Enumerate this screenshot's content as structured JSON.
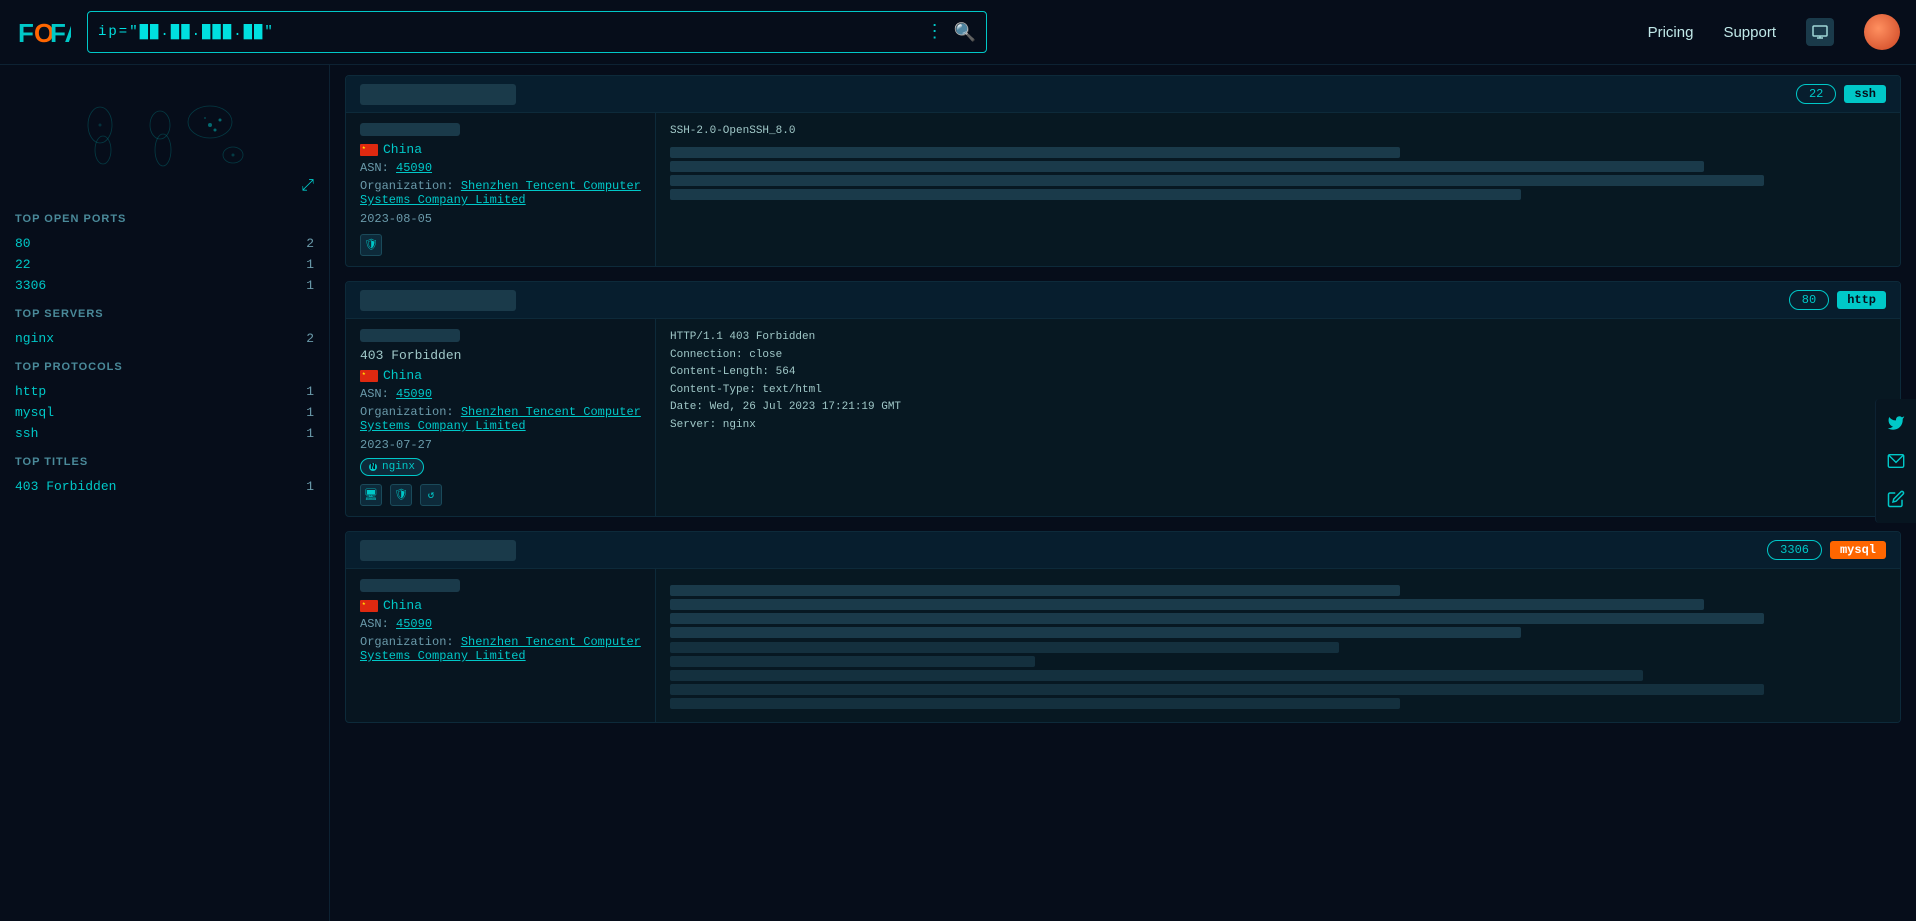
{
  "header": {
    "logo_text": "FOFA",
    "search_value": "ip=\"██.██.███.██\"",
    "nav": {
      "pricing": "Pricing",
      "support": "Support"
    }
  },
  "sidebar": {
    "map_expand": "⤢",
    "sections": [
      {
        "title": "TOP OPEN PORTS",
        "items": [
          {
            "label": "80",
            "count": "2"
          },
          {
            "label": "22",
            "count": "1"
          },
          {
            "label": "3306",
            "count": "1"
          }
        ]
      },
      {
        "title": "TOP SERVERS",
        "items": [
          {
            "label": "nginx",
            "count": "2"
          }
        ]
      },
      {
        "title": "TOP PROTOCOLS",
        "items": [
          {
            "label": "http",
            "count": "1"
          },
          {
            "label": "mysql",
            "count": "1"
          },
          {
            "label": "ssh",
            "count": "1"
          }
        ]
      },
      {
        "title": "TOP TITLES",
        "items": [
          {
            "label": "403 Forbidden",
            "count": "1"
          }
        ]
      }
    ]
  },
  "results": [
    {
      "ip": "██.███.██.████",
      "ip_display": "█▐·█▌·█",
      "port": "22",
      "protocol": "ssh",
      "protocol_color": "cyan",
      "country": "China",
      "asn": "45090",
      "org": "Shenzhen Tencent Computer Systems Company Limited",
      "date": "2023-08-05",
      "response_header": "SSH-2.0-OpenSSH_8.0",
      "response_blurred": true,
      "icons": [
        "shield"
      ]
    },
    {
      "ip": "██.███.██.██·∞",
      "ip_display": "█▐·█▌·█·∞",
      "port": "80",
      "protocol": "http",
      "protocol_color": "cyan",
      "title": "403 Forbidden",
      "country": "China",
      "asn": "45090",
      "org": "Shenzhen Tencent Computer Systems Company Limited",
      "date": "2023-07-27",
      "response_header": "HTTP/1.1 403 Forbidden\nConnection: close\nContent-Length: 564\nContent-Type: text/html\nDate: Wed, 26 Jul 2023 17:21:19 GMT\nServer: nginx",
      "server_tag": "nginx",
      "icons": [
        "screen",
        "shield",
        "refresh"
      ]
    },
    {
      "ip": "███.██.███.███·██",
      "ip_display": "█▐·█▌·█·██",
      "port": "3306",
      "protocol": "mysql",
      "protocol_color": "orange",
      "country": "China",
      "asn": "45090",
      "org": "Shenzhen Tencent Computer Systems Company Limited",
      "date": "",
      "response_header": "",
      "response_blurred": true,
      "icons": []
    }
  ],
  "social": {
    "icons": [
      "twitter",
      "email",
      "edit"
    ]
  }
}
